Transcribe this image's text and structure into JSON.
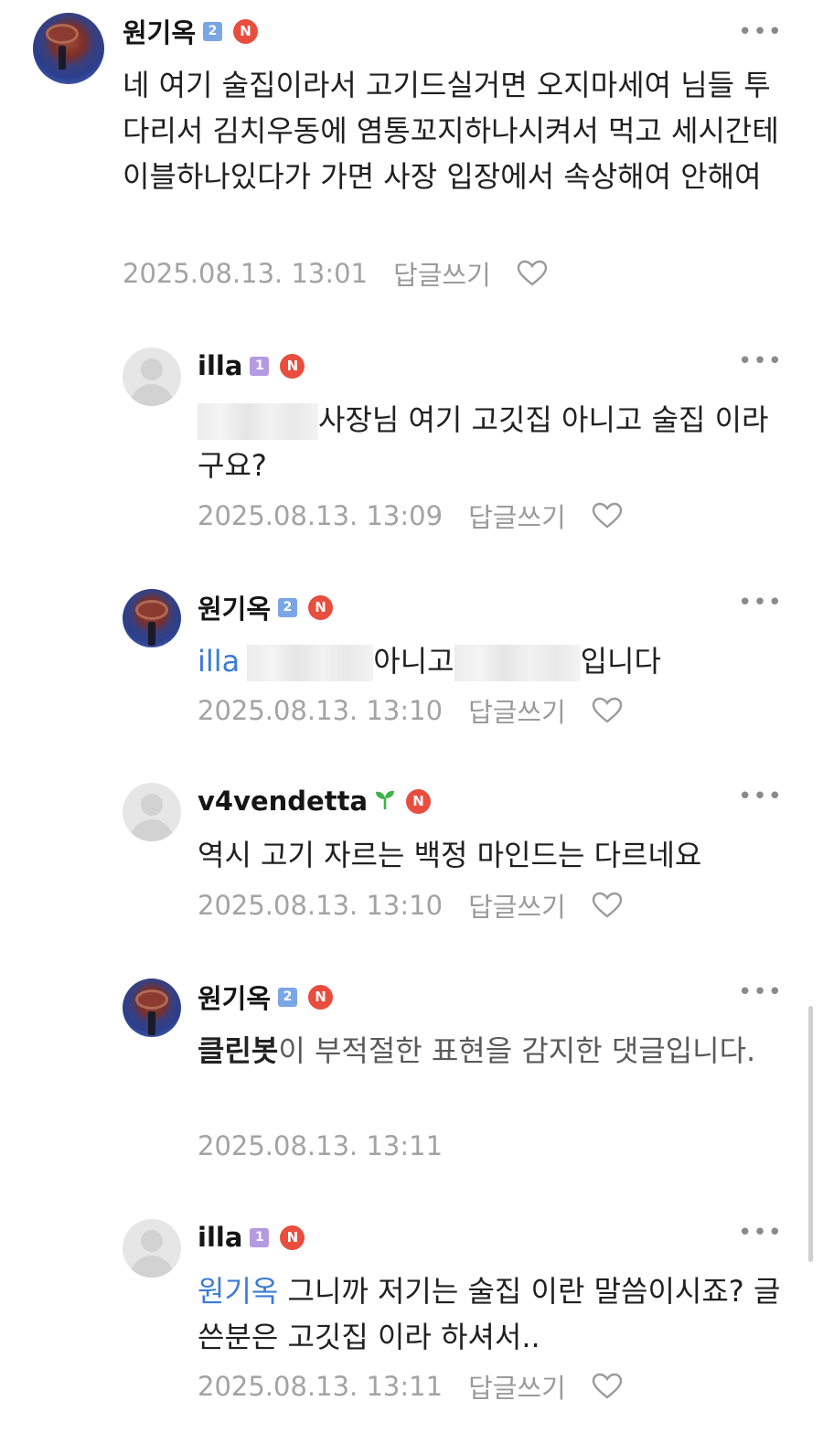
{
  "comments": [
    {
      "author": "원기옥",
      "level": "2",
      "text": "네 여기 술집이라서 고기드실거면 오지마세여 님들 투다리서 김치우동에 염통꼬지하나시켜서 먹고 세시간테이블하나있다가 가면 사장 입장에서 속상해여 안해여",
      "timestamp": "2025.08.13. 13:01",
      "reply_label": "답글쓰기"
    },
    {
      "author": "illa",
      "level": "1",
      "text": "사장님 여기 고깃집 아니고 술집 이라구요?",
      "timestamp": "2025.08.13. 13:09",
      "reply_label": "답글쓰기"
    },
    {
      "author": "원기옥",
      "level": "2",
      "mention": "illa",
      "text_a": "아니고",
      "text_b": "입니다",
      "timestamp": "2025.08.13. 13:10",
      "reply_label": "답글쓰기"
    },
    {
      "author": "v4vendetta",
      "text": "역시 고기 자르는 백정 마인드는 다르네요",
      "timestamp": "2025.08.13. 13:10",
      "reply_label": "답글쓰기"
    },
    {
      "author": "원기옥",
      "level": "2",
      "cleanbot": "클린봇",
      "text": "이 부적절한 표현을 감지한 댓글입니다.",
      "timestamp": "2025.08.13. 13:11"
    },
    {
      "author": "illa",
      "level": "1",
      "mention": "원기옥",
      "text": "그니까 저기는 술집 이란 말씀이시죠? 글쓴분은 고깃집 이라 하셔서..",
      "timestamp": "2025.08.13. 13:11",
      "reply_label": "답글쓰기"
    }
  ],
  "badge_letter": "N",
  "more_glyph": "•••",
  "icons": {
    "level_badge": "level-icon",
    "naver_badge": "n-badge-icon",
    "sprout": "sprout-icon",
    "heart": "heart-icon",
    "more": "more-icon"
  },
  "colors": {
    "mention": "#3c7bd6",
    "n_badge": "#e84d3d",
    "level2": "#7aa6e6",
    "level1": "#b49ae0",
    "meta": "#a3a3a3"
  }
}
